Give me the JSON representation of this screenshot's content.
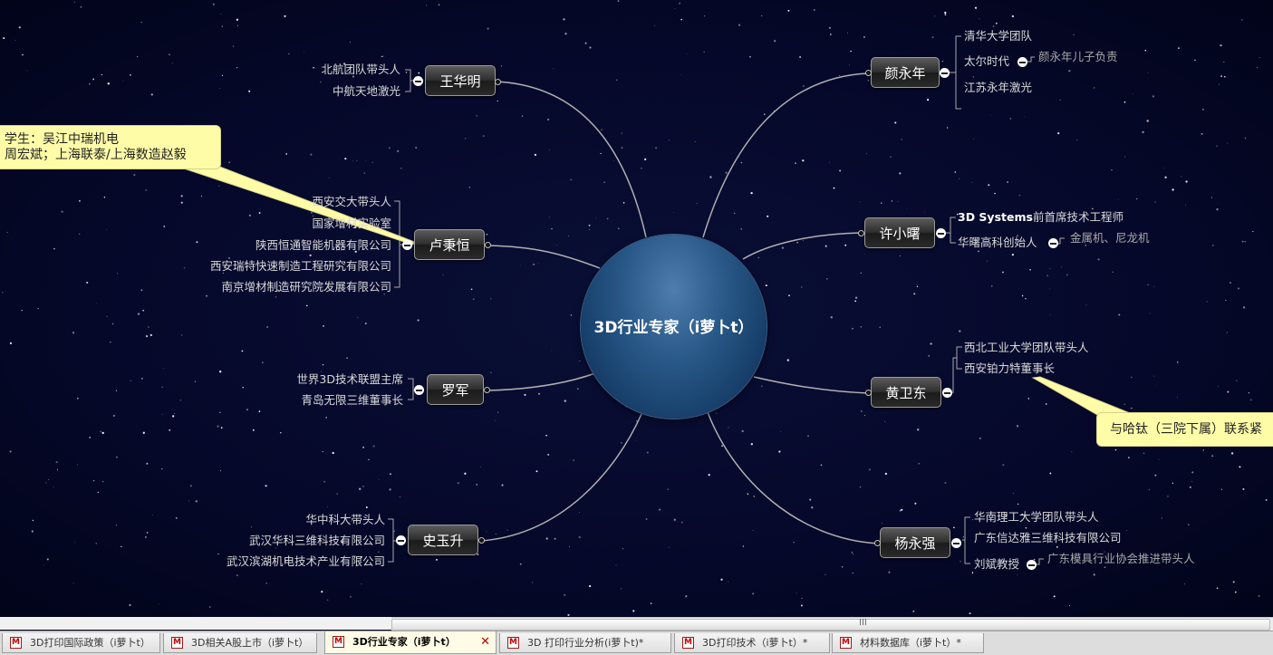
{
  "map": {
    "central": "3D行业专家（i萝卜t）",
    "topics": [
      {
        "name": "王华明",
        "items": [
          "北航团队带头人",
          "中航天地激光"
        ]
      },
      {
        "name": "卢秉恒",
        "items": [
          "西安交大带头人",
          "国家增材实验室",
          "陕西恒通智能机器有限公司",
          "西安瑞特快速制造工程研究有限公司",
          "南京增材制造研究院发展有限公司"
        ]
      },
      {
        "name": "罗军",
        "items": [
          "世界3D技术联盟主席",
          "青岛无限三维董事长"
        ]
      },
      {
        "name": "史玉升",
        "items": [
          "华中科大带头人",
          "武汉华科三维科技有限公司",
          "武汉滨湖机电技术产业有限公司"
        ]
      },
      {
        "name": "颜永年",
        "items": [
          "清华大学团队",
          "太尔时代",
          "江苏永年激光"
        ],
        "note": "颜永年儿子负责"
      },
      {
        "name": "许小曙",
        "items": [
          "3D Systems前首席技术工程师",
          "华曙高科创始人"
        ],
        "note": "金属机、尼龙机"
      },
      {
        "name": "黄卫东",
        "items": [
          "西北工业大学团队带头人",
          "西安铂力特董事长"
        ]
      },
      {
        "name": "杨永强",
        "items": [
          "华南理工大学团队带头人",
          "广东信达雅三维科技有限公司",
          "刘斌教授"
        ],
        "note": "广东模具行业协会推进带头人"
      }
    ],
    "callouts": {
      "luoheng_line1": "学生：吴江中瑞机电",
      "luoheng_line2": "周宏斌；上海联泰/上海数造赵毅",
      "huang": "与哈钛（三院下属）联系紧"
    }
  },
  "scrollbar": {
    "grip": "III"
  },
  "tabs": [
    {
      "label": "3D打印国际政策（i萝卜t）",
      "active": false
    },
    {
      "label": "3D相关A股上市（i萝卜t）",
      "active": false
    },
    {
      "label": "3D行业专家（i萝卜t）",
      "active": true
    },
    {
      "label": "3D 打印行业分析(i萝卜t)*",
      "active": false
    },
    {
      "label": "3D打印技术（i萝卜t）*",
      "active": false
    },
    {
      "label": "材料数据库（i萝卜t）*",
      "active": false
    }
  ],
  "icons": {
    "tab": "mindmap-file-icon",
    "close": "close-icon"
  },
  "colors": {
    "background": "#03061f",
    "central": "#1d4a7a",
    "callout": "#fffca8",
    "close": "#c00000"
  }
}
